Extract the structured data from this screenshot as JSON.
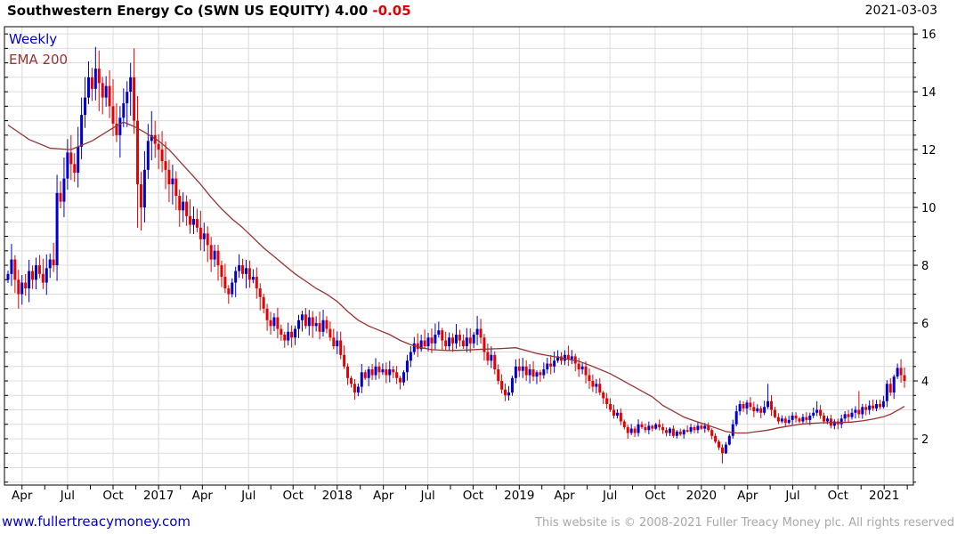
{
  "header": {
    "title": "Southwestern Energy Co (SWN US EQUITY)",
    "last_price": "4.00",
    "change": "-0.05",
    "date": "2021-03-03"
  },
  "legend": {
    "series": "Weekly",
    "overlay": "EMA 200"
  },
  "footer": {
    "site": "www.fullertreacymoney.com",
    "copyright": "This website is © 2008-2021 Fuller Treacy Money plc. All rights reserved"
  },
  "chart_data": {
    "type": "candlestick",
    "title": "Southwestern Energy Co (SWN US EQUITY)",
    "interval": "Weekly",
    "overlay": "EMA 200",
    "as_of": "2021-03-03",
    "last_close": 4.0,
    "change": -0.05,
    "grid": "on",
    "legend_position": "top-left",
    "y_axis": {
      "min": 0.4,
      "max": 16.25,
      "tick_labels": [
        16,
        14,
        12,
        10,
        8,
        6,
        4,
        2
      ],
      "grid_step": 0.5,
      "side": "right"
    },
    "x_ticks": [
      {
        "label": "Apr",
        "week": 4
      },
      {
        "label": "Jul",
        "week": 17
      },
      {
        "label": "Oct",
        "week": 30
      },
      {
        "label": "2017",
        "week": 43
      },
      {
        "label": "Apr",
        "week": 55.5
      },
      {
        "label": "Jul",
        "week": 68.7
      },
      {
        "label": "Oct",
        "week": 81.4
      },
      {
        "label": "2018",
        "week": 94
      },
      {
        "label": "Apr",
        "week": 107.2
      },
      {
        "label": "Jul",
        "week": 119.9
      },
      {
        "label": "Oct",
        "week": 132.8
      },
      {
        "label": "2019",
        "week": 146
      },
      {
        "label": "Apr",
        "week": 158.9
      },
      {
        "label": "Jul",
        "week": 171.9
      },
      {
        "label": "Oct",
        "week": 184.8
      },
      {
        "label": "2020",
        "week": 198
      },
      {
        "label": "Apr",
        "week": 211.2
      },
      {
        "label": "Jul",
        "week": 224.1
      },
      {
        "label": "Oct",
        "week": 237
      },
      {
        "label": "2021",
        "week": 250.2
      }
    ],
    "first_open": 7.5,
    "closes": [
      7.7,
      8.2,
      7.5,
      7.0,
      7.4,
      7.2,
      7.8,
      7.5,
      8.0,
      7.7,
      7.4,
      7.9,
      8.2,
      8.0,
      10.5,
      10.2,
      11.0,
      11.9,
      11.5,
      11.2,
      12.1,
      13.2,
      13.8,
      14.5,
      14.1,
      14.8,
      14.3,
      13.8,
      14.2,
      13.5,
      12.9,
      12.5,
      13.1,
      13.6,
      14.0,
      14.5,
      13.0,
      10.8,
      10.0,
      11.3,
      12.3,
      12.5,
      12.2,
      12.0,
      11.6,
      11.3,
      10.8,
      11.0,
      10.4,
      9.9,
      10.2,
      9.7,
      9.4,
      9.6,
      9.3,
      8.9,
      9.1,
      8.7,
      8.2,
      8.5,
      8.0,
      7.6,
      7.2,
      7.0,
      7.4,
      7.8,
      8.0,
      7.7,
      7.9,
      7.5,
      7.6,
      7.2,
      6.9,
      6.5,
      6.1,
      5.9,
      6.2,
      5.8,
      5.6,
      5.4,
      5.7,
      5.5,
      5.8,
      6.1,
      6.3,
      5.9,
      6.2,
      5.9,
      6.0,
      5.7,
      6.1,
      5.8,
      5.5,
      5.2,
      5.4,
      4.9,
      4.5,
      4.1,
      3.9,
      3.6,
      3.8,
      4.3,
      4.1,
      4.4,
      4.2,
      4.5,
      4.3,
      4.4,
      4.2,
      4.4,
      4.3,
      4.1,
      3.95,
      4.3,
      4.7,
      5.0,
      5.3,
      5.1,
      5.4,
      5.2,
      5.5,
      5.3,
      5.6,
      5.75,
      5.4,
      5.2,
      5.5,
      5.3,
      5.6,
      5.4,
      5.2,
      5.5,
      5.3,
      5.6,
      5.8,
      5.5,
      5.0,
      4.7,
      4.9,
      4.4,
      4.0,
      3.7,
      3.5,
      3.6,
      4.1,
      4.5,
      4.35,
      4.5,
      4.2,
      4.4,
      4.15,
      4.3,
      4.2,
      4.4,
      4.6,
      4.5,
      4.7,
      4.85,
      4.7,
      4.9,
      4.75,
      4.85,
      4.6,
      4.4,
      4.5,
      4.2,
      4.0,
      3.8,
      3.9,
      3.6,
      3.4,
      3.2,
      3.0,
      2.8,
      2.9,
      2.6,
      2.4,
      2.2,
      2.35,
      2.2,
      2.5,
      2.4,
      2.3,
      2.45,
      2.35,
      2.5,
      2.4,
      2.3,
      2.2,
      2.35,
      2.1,
      2.25,
      2.15,
      2.3,
      2.25,
      2.4,
      2.3,
      2.45,
      2.35,
      2.45,
      2.3,
      2.1,
      1.9,
      1.7,
      1.5,
      1.8,
      2.1,
      2.5,
      2.95,
      3.2,
      3.05,
      3.25,
      3.1,
      2.95,
      3.05,
      2.9,
      3.1,
      3.3,
      3.0,
      2.75,
      2.6,
      2.7,
      2.55,
      2.65,
      2.8,
      2.7,
      2.6,
      2.75,
      2.65,
      2.8,
      2.9,
      3.0,
      2.8,
      2.6,
      2.7,
      2.45,
      2.6,
      2.5,
      2.7,
      2.85,
      2.75,
      2.9,
      3.0,
      2.85,
      3.1,
      3.0,
      3.15,
      3.05,
      3.2,
      3.1,
      3.3,
      3.9,
      3.6,
      4.15,
      4.45,
      4.2,
      4.0
    ],
    "wick_overrides": {
      "3": {
        "low": 6.5
      },
      "25": {
        "high": 15.55
      },
      "35": {
        "high": 15.0
      },
      "37": {
        "low": 9.3
      },
      "38": {
        "low": 9.2
      },
      "99": {
        "low": 3.35
      },
      "123": {
        "high": 6.05
      },
      "134": {
        "high": 6.25
      },
      "142": {
        "low": 3.3
      },
      "177": {
        "low": 2.0
      },
      "204": {
        "low": 1.15
      },
      "217": {
        "high": 3.9
      },
      "231": {
        "high": 3.3
      },
      "243": {
        "high": 3.65
      },
      "254": {
        "high": 4.6
      }
    },
    "ema_points": [
      [
        0,
        12.85
      ],
      [
        6,
        12.35
      ],
      [
        12,
        12.05
      ],
      [
        18,
        12.0
      ],
      [
        24,
        12.3
      ],
      [
        30,
        12.75
      ],
      [
        33,
        12.95
      ],
      [
        36,
        12.8
      ],
      [
        39,
        12.6
      ],
      [
        43,
        12.3
      ],
      [
        46,
        12.0
      ],
      [
        49,
        11.6
      ],
      [
        52,
        11.2
      ],
      [
        55,
        10.8
      ],
      [
        58,
        10.35
      ],
      [
        61,
        9.95
      ],
      [
        64,
        9.6
      ],
      [
        67,
        9.3
      ],
      [
        70,
        8.95
      ],
      [
        73,
        8.6
      ],
      [
        76,
        8.3
      ],
      [
        79,
        8.0
      ],
      [
        82,
        7.7
      ],
      [
        85,
        7.45
      ],
      [
        88,
        7.2
      ],
      [
        91,
        7.0
      ],
      [
        94,
        6.75
      ],
      [
        97,
        6.4
      ],
      [
        100,
        6.1
      ],
      [
        103,
        5.9
      ],
      [
        106,
        5.75
      ],
      [
        109,
        5.6
      ],
      [
        112,
        5.4
      ],
      [
        115,
        5.25
      ],
      [
        118,
        5.15
      ],
      [
        121,
        5.08
      ],
      [
        126,
        5.05
      ],
      [
        131,
        5.07
      ],
      [
        136,
        5.1
      ],
      [
        141,
        5.12
      ],
      [
        145,
        5.15
      ],
      [
        148,
        5.05
      ],
      [
        151,
        4.95
      ],
      [
        154,
        4.88
      ],
      [
        157,
        4.82
      ],
      [
        160,
        4.75
      ],
      [
        163,
        4.68
      ],
      [
        166,
        4.55
      ],
      [
        169,
        4.4
      ],
      [
        172,
        4.25
      ],
      [
        175,
        4.05
      ],
      [
        178,
        3.85
      ],
      [
        181,
        3.65
      ],
      [
        184,
        3.45
      ],
      [
        187,
        3.15
      ],
      [
        190,
        2.95
      ],
      [
        193,
        2.75
      ],
      [
        196,
        2.62
      ],
      [
        199,
        2.5
      ],
      [
        202,
        2.38
      ],
      [
        205,
        2.25
      ],
      [
        208,
        2.2
      ],
      [
        211,
        2.2
      ],
      [
        214,
        2.25
      ],
      [
        217,
        2.3
      ],
      [
        220,
        2.38
      ],
      [
        223,
        2.44
      ],
      [
        226,
        2.5
      ],
      [
        229,
        2.53
      ],
      [
        232,
        2.55
      ],
      [
        235,
        2.56
      ],
      [
        238,
        2.56
      ],
      [
        241,
        2.58
      ],
      [
        244,
        2.62
      ],
      [
        247,
        2.68
      ],
      [
        250,
        2.76
      ],
      [
        252,
        2.85
      ],
      [
        254,
        2.98
      ],
      [
        256,
        3.12
      ]
    ],
    "colors": {
      "up_candle": "#0000cc",
      "down_candle": "#e60000",
      "ema_line": "#993333",
      "grid": "#dcdcdc",
      "axis_border": "#000000",
      "label_text": "#000000",
      "change_negative": "#e60000",
      "link": "#0000cc",
      "copyright_gray": "#a8a8a8"
    }
  }
}
